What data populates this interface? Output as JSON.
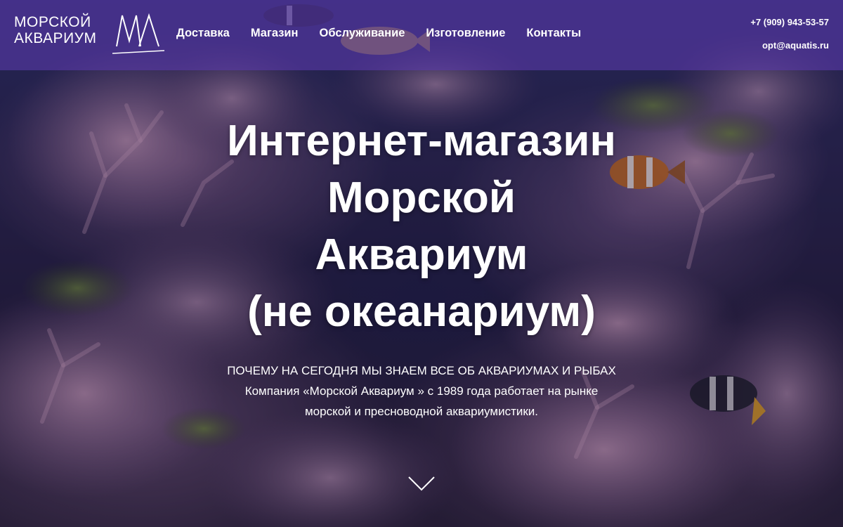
{
  "brand": {
    "logo_line1": "МОРСКОЙ",
    "logo_line2": "АКВАРИУМ",
    "logo_mark": "MA"
  },
  "nav": {
    "items": [
      {
        "label": "Доставка"
      },
      {
        "label": "Магазин"
      },
      {
        "label": "Обслуживание"
      },
      {
        "label": "Изготовление"
      },
      {
        "label": "Контакты"
      }
    ]
  },
  "contacts": {
    "phone": "+7 (909) 943-53-57",
    "email": "opt@aquatis.ru"
  },
  "hero": {
    "title_lines": [
      "Интернет-магазин",
      "Морской",
      "Аквариум",
      "(не океанариум)"
    ],
    "subtitle_lines": [
      "ПОЧЕМУ НА СЕГОДНЯ МЫ ЗНАЕМ ВСЕ ОБ АКВАРИУМАХ И РЫБАХ",
      "Компания «Морской Аквариум » с 1989 года работает на рынке",
      "морской и пресноводной аквариумистики."
    ]
  },
  "icons": {
    "scroll": "chevron-down-icon"
  },
  "colors": {
    "header_bg": "#5838aa",
    "text": "#ffffff"
  }
}
